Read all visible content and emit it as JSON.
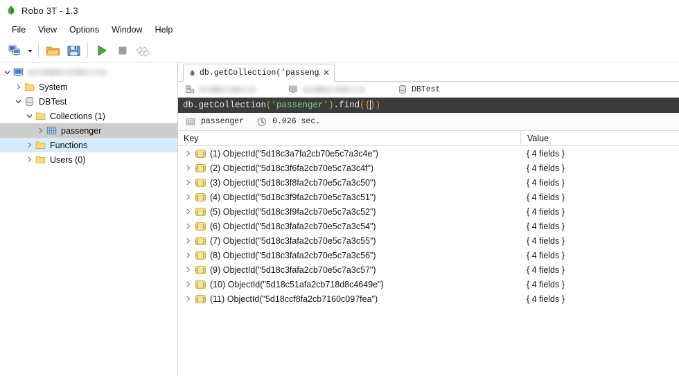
{
  "window": {
    "title": "Robo 3T - 1.3",
    "app_icon": "robo3t-leaf-icon"
  },
  "menu": {
    "items": [
      {
        "label": "File"
      },
      {
        "label": "View"
      },
      {
        "label": "Options"
      },
      {
        "label": "Window"
      },
      {
        "label": "Help"
      }
    ]
  },
  "toolbar": {
    "buttons": [
      {
        "name": "connect-button",
        "icon": "connect-icon"
      },
      {
        "name": "connect-dropdown",
        "icon": "chevron-down-icon"
      },
      {
        "name": "open-script-button",
        "icon": "folder-open-icon"
      },
      {
        "name": "save-script-button",
        "icon": "floppy-save-icon"
      },
      {
        "name": "execute-button",
        "icon": "play-icon"
      },
      {
        "name": "stop-button",
        "icon": "stop-icon"
      },
      {
        "name": "orientation-button",
        "icon": "split-layout-icon"
      }
    ]
  },
  "sidebar": {
    "nodes": [
      {
        "label": "",
        "redacted": true,
        "icon": "server-monitor-icon",
        "twisty": "expanded",
        "indent": 0,
        "state": "normal"
      },
      {
        "label": "System",
        "redacted": false,
        "icon": "folder-icon",
        "twisty": "collapsed",
        "indent": 1,
        "state": "normal"
      },
      {
        "label": "DBTest",
        "redacted": false,
        "icon": "database-icon",
        "twisty": "expanded",
        "indent": 1,
        "state": "normal"
      },
      {
        "label": "Collections (1)",
        "redacted": false,
        "icon": "folder-icon",
        "twisty": "expanded",
        "indent": 2,
        "state": "normal"
      },
      {
        "label": "passenger",
        "redacted": false,
        "icon": "collection-grid-icon",
        "twisty": "collapsed",
        "indent": 3,
        "state": "selected"
      },
      {
        "label": "Functions",
        "redacted": false,
        "icon": "folder-icon",
        "twisty": "collapsed",
        "indent": 2,
        "state": "hovered"
      },
      {
        "label": "Users (0)",
        "redacted": false,
        "icon": "folder-icon",
        "twisty": "collapsed",
        "indent": 2,
        "state": "normal"
      }
    ]
  },
  "tab": {
    "label": "db.getCollection('passeng…",
    "close_label": "✕",
    "icon": "green-leaf-icon"
  },
  "connection_bar": {
    "items": [
      {
        "name": "connection-name",
        "icon": "server-icon",
        "label": "",
        "redacted": true
      },
      {
        "name": "host-name",
        "icon": "monitor-icon",
        "label": "",
        "redacted": true
      },
      {
        "name": "database-name",
        "icon": "database-icon",
        "label": "DBTest",
        "redacted": false
      }
    ]
  },
  "editor": {
    "tokens": [
      {
        "text": "db.getCollection",
        "type": "plain"
      },
      {
        "text": "(",
        "type": "brace"
      },
      {
        "text": "'passenger'",
        "type": "string"
      },
      {
        "text": ")",
        "type": "brace"
      },
      {
        "text": ".find",
        "type": "plain"
      },
      {
        "text": "(",
        "type": "brace"
      },
      {
        "text": "{",
        "type": "brace"
      },
      {
        "text": "}",
        "type": "brace"
      },
      {
        "text": ")",
        "type": "brace"
      }
    ],
    "full_text": "db.getCollection('passenger').find({})"
  },
  "result_status": {
    "collection": "passenger",
    "collection_icon": "collection-grid-icon",
    "time_icon": "clock-icon",
    "time": "0.026 sec."
  },
  "results": {
    "columns": {
      "key": "Key",
      "value": "Value"
    },
    "rows": [
      {
        "index": "(1)",
        "key": "ObjectId(\"5d18c3a7fa2cb70e5c7a3c4e\")",
        "value": "{ 4 fields }"
      },
      {
        "index": "(2)",
        "key": "ObjectId(\"5d18c3f6fa2cb70e5c7a3c4f\")",
        "value": "{ 4 fields }"
      },
      {
        "index": "(3)",
        "key": "ObjectId(\"5d18c3f8fa2cb70e5c7a3c50\")",
        "value": "{ 4 fields }"
      },
      {
        "index": "(4)",
        "key": "ObjectId(\"5d18c3f9fa2cb70e5c7a3c51\")",
        "value": "{ 4 fields }"
      },
      {
        "index": "(5)",
        "key": "ObjectId(\"5d18c3f9fa2cb70e5c7a3c52\")",
        "value": "{ 4 fields }"
      },
      {
        "index": "(6)",
        "key": "ObjectId(\"5d18c3fafa2cb70e5c7a3c54\")",
        "value": "{ 4 fields }"
      },
      {
        "index": "(7)",
        "key": "ObjectId(\"5d18c3fafa2cb70e5c7a3c55\")",
        "value": "{ 4 fields }"
      },
      {
        "index": "(8)",
        "key": "ObjectId(\"5d18c3fafa2cb70e5c7a3c56\")",
        "value": "{ 4 fields }"
      },
      {
        "index": "(9)",
        "key": "ObjectId(\"5d18c3fafa2cb70e5c7a3c57\")",
        "value": "{ 4 fields }"
      },
      {
        "index": "(10)",
        "key": "ObjectId(\"5d18c51afa2cb718d8c4649e\")",
        "value": "{ 4 fields }"
      },
      {
        "index": "(11)",
        "key": "ObjectId(\"5d18ccf8fa2cb7160c097fea\")",
        "value": "{ 4 fields }"
      }
    ],
    "row_icon": "json-document-icon"
  },
  "colors": {
    "editor_background": "#3b3b3b",
    "editor_string": "#7fd97f",
    "selection_gray": "#cdcdcd",
    "hover_blue": "#d6ebfb",
    "folder_yellow": "#f0c040",
    "execute_green": "#3f9c35"
  }
}
